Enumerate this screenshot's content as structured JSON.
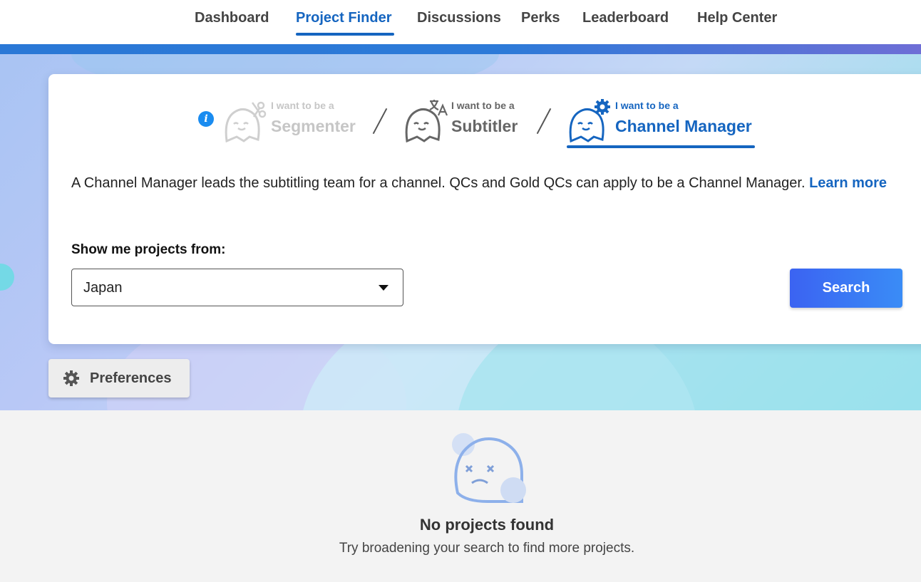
{
  "nav": {
    "items": [
      {
        "label": "Dashboard"
      },
      {
        "label": "Project Finder"
      },
      {
        "label": "Discussions"
      },
      {
        "label": "Perks"
      },
      {
        "label": "Leaderboard"
      },
      {
        "label": "Help Center"
      }
    ],
    "active_label": "Project Finder"
  },
  "roles": {
    "prefix": "I want to be a",
    "items": [
      {
        "label": "Segmenter",
        "icon": "scissors-icon"
      },
      {
        "label": "Subtitler",
        "icon": "translate-icon"
      },
      {
        "label": "Channel Manager",
        "icon": "gear-icon"
      }
    ],
    "active_label": "Channel Manager"
  },
  "description": {
    "text": "A Channel Manager leads the subtitling team for a channel. QCs and Gold QCs can apply to be a Channel Manager.",
    "link_label": "Learn more"
  },
  "filter": {
    "label": "Show me projects from:",
    "selected": "Japan"
  },
  "search_label": "Search",
  "preferences_label": "Preferences",
  "empty": {
    "title": "No projects found",
    "subtitle": "Try broadening your search to find more projects."
  },
  "colors": {
    "accent": "#1565c0",
    "search_gradient_start": "#3b63f2",
    "search_gradient_end": "#3a8cf6",
    "info": "#1a8cf0"
  }
}
